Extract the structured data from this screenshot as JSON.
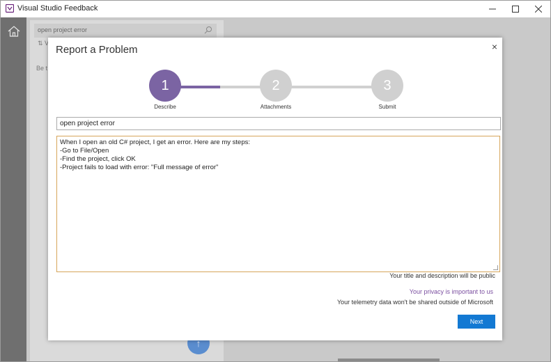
{
  "window": {
    "title": "Visual Studio Feedback"
  },
  "background": {
    "search_value": "open project error",
    "sort_label": "⇅ V",
    "partial_text": "Be t"
  },
  "dialog": {
    "title": "Report a Problem",
    "close": "×",
    "steps": [
      {
        "number": "1",
        "label": "Describe"
      },
      {
        "number": "2",
        "label": "Attachments"
      },
      {
        "number": "3",
        "label": "Submit"
      }
    ],
    "title_value": "open project error",
    "description_lines": [
      "When I open an old C# project, I get an error. Here are my steps:",
      "-Go to File/Open",
      "-Find the project, click OK",
      "-Project fails to load with error: \"Full message of error\""
    ],
    "public_note": "Your title and description will be public",
    "privacy_link": "Your privacy is important to us",
    "telemetry_note": "Your telemetry data won't be shared outside of Microsoft",
    "next_label": "Next"
  },
  "colors": {
    "accent_purple": "#7b64a3",
    "primary_button": "#1379d3",
    "focus_border": "#d6a55a"
  }
}
